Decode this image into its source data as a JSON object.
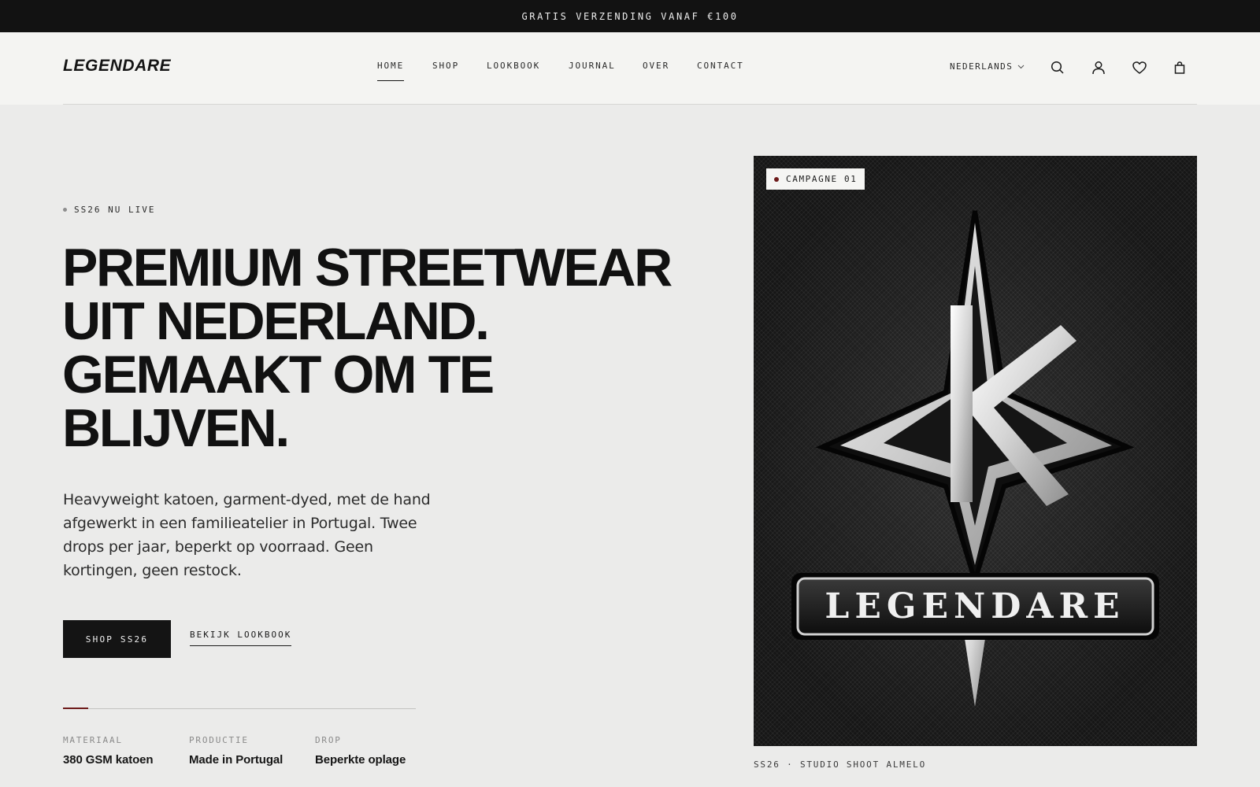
{
  "announcement": "GRATIS VERZENDING VANAF €100",
  "brand": {
    "logo": "LEGENDARE"
  },
  "nav": {
    "items": [
      {
        "label": "HOME",
        "active": true
      },
      {
        "label": "SHOP"
      },
      {
        "label": "LOOKBOOK"
      },
      {
        "label": "JOURNAL"
      },
      {
        "label": "OVER"
      },
      {
        "label": "CONTACT"
      }
    ]
  },
  "header_actions": {
    "language": "NEDERLANDS",
    "icons": [
      "chevron-down-icon",
      "search-icon",
      "account-icon",
      "wishlist-heart-icon",
      "shopping-bag-icon"
    ]
  },
  "hero": {
    "eyebrow": "SS26 NU LIVE",
    "headline_lines": [
      "PREMIUM STREETWEAR",
      "UIT NEDERLAND.",
      "GEMAAKT OM TE",
      "BLIJVEN."
    ],
    "lede": "Heavyweight katoen, garment-dyed, met de hand afgewerkt in een familieatelier in Portugal. Twee drops per jaar, beperkt op voorraad. Geen kortingen, geen restock.",
    "primary_cta": "SHOP SS26",
    "secondary_cta": "BEKIJK LOOKBOOK",
    "stats": [
      {
        "label": "MATERIAAL",
        "value": "380 GSM katoen"
      },
      {
        "label": "PRODUCTIE",
        "value": "Made in Portugal"
      },
      {
        "label": "DROP",
        "value": "Beperkte oplage"
      }
    ]
  },
  "campaign": {
    "badge": "CAMPAGNE 01",
    "image_logo_text": "LEGENDARE",
    "caption": "SS26 · STUDIO SHOOT ALMELO"
  },
  "colors": {
    "background": "#ebebea",
    "header_background": "#f4f4f2",
    "announcement_background": "#121212",
    "text": "#131313",
    "accent_dark_red": "#6d1a1a",
    "muted_label": "#8a8a8a"
  }
}
